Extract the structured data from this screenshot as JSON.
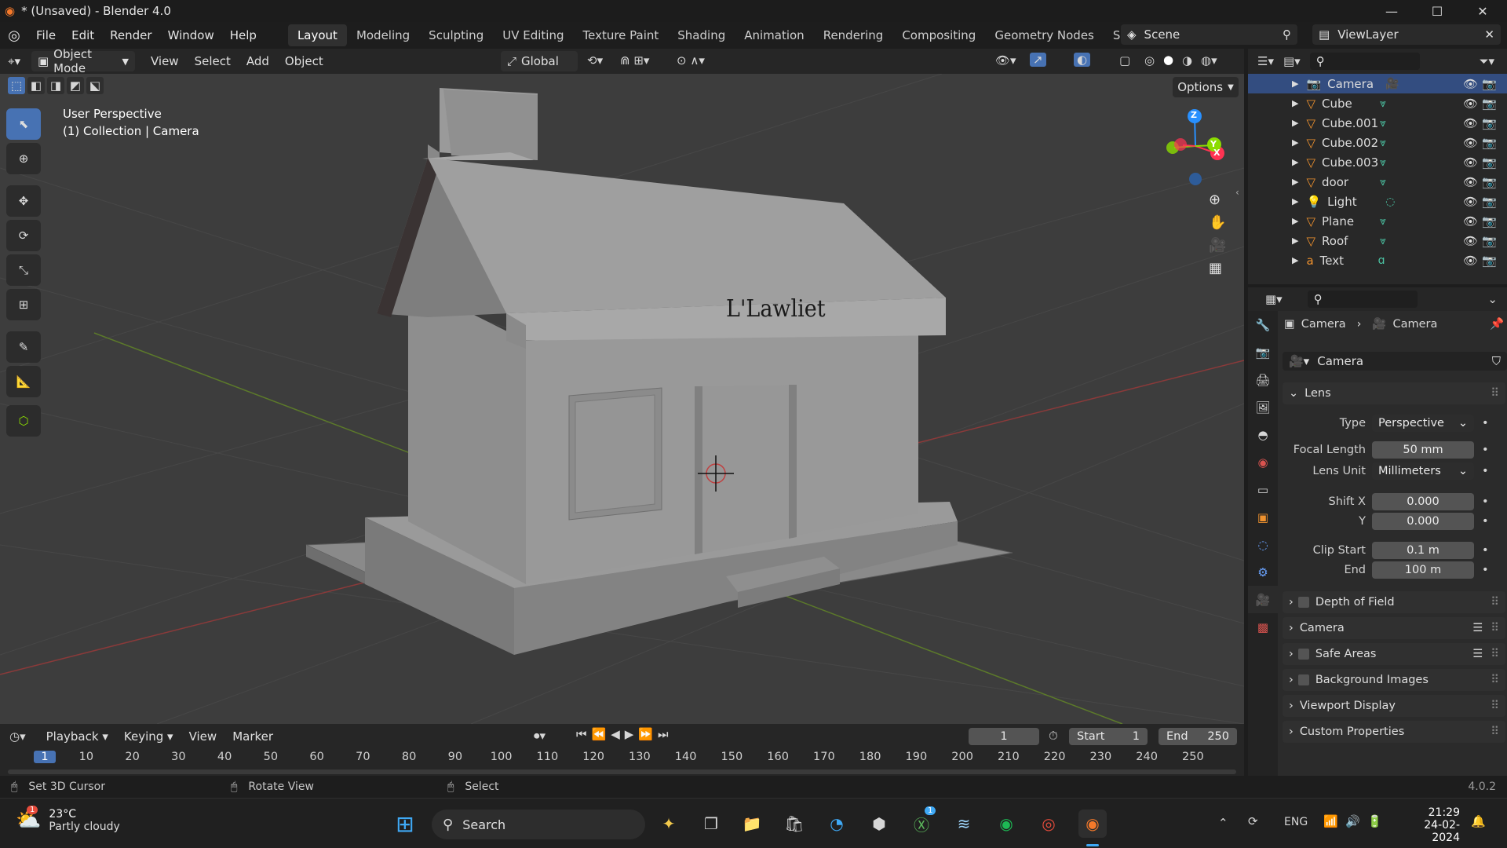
{
  "window": {
    "title": "* (Unsaved) - Blender 4.0",
    "minimize": "—",
    "maximize": "☐",
    "close": "✕"
  },
  "menu": {
    "items": [
      "File",
      "Edit",
      "Render",
      "Window",
      "Help"
    ]
  },
  "workspaces": {
    "tabs": [
      "Layout",
      "Modeling",
      "Sculpting",
      "UV Editing",
      "Texture Paint",
      "Shading",
      "Animation",
      "Rendering",
      "Compositing",
      "Geometry Nodes",
      "Scripting"
    ],
    "active": "Layout",
    "add": "+"
  },
  "scene": {
    "name": "Scene",
    "view_layer": "ViewLayer"
  },
  "viewport_header": {
    "mode": "Object Mode",
    "menus": [
      "View",
      "Select",
      "Add",
      "Object"
    ],
    "orientation": "Global",
    "options": "Options"
  },
  "viewport": {
    "perspective": "User Perspective",
    "context": "(1) Collection | Camera",
    "sign_text": "L'Lawliet"
  },
  "gizmo": {
    "x": "X",
    "y": "Y",
    "z": "Z"
  },
  "outliner": {
    "items": [
      {
        "name": "Camera",
        "type": "camera",
        "selected": true
      },
      {
        "name": "Cube",
        "type": "mesh",
        "selected": false
      },
      {
        "name": "Cube.001",
        "type": "mesh",
        "selected": false
      },
      {
        "name": "Cube.002",
        "type": "mesh",
        "selected": false
      },
      {
        "name": "Cube.003",
        "type": "mesh",
        "selected": false
      },
      {
        "name": "door",
        "type": "mesh",
        "selected": false
      },
      {
        "name": "Light",
        "type": "light",
        "selected": false
      },
      {
        "name": "Plane",
        "type": "mesh",
        "selected": false
      },
      {
        "name": "Roof",
        "type": "mesh",
        "selected": false
      },
      {
        "name": "Text",
        "type": "text",
        "selected": false
      }
    ]
  },
  "properties": {
    "breadcrumb": [
      "Camera",
      "Camera"
    ],
    "datablock": "Camera",
    "lens_section": "Lens",
    "type_label": "Type",
    "type_value": "Perspective",
    "focal_label": "Focal Length",
    "focal_value": "50 mm",
    "lens_unit_label": "Lens Unit",
    "lens_unit_value": "Millimeters",
    "shift_x_label": "Shift X",
    "shift_x_value": "0.000",
    "shift_y_label": "Y",
    "shift_y_value": "0.000",
    "clip_start_label": "Clip Start",
    "clip_start_value": "0.1 m",
    "clip_end_label": "End",
    "clip_end_value": "100 m",
    "panels": [
      "Depth of Field",
      "Camera",
      "Safe Areas",
      "Background Images",
      "Viewport Display",
      "Custom Properties"
    ]
  },
  "timeline": {
    "menus": [
      "Playback",
      "Keying",
      "View",
      "Marker"
    ],
    "current_frame": "1",
    "start_label": "Start",
    "start_value": "1",
    "end_label": "End",
    "end_value": "250",
    "ticks": [
      "1",
      "10",
      "20",
      "30",
      "40",
      "50",
      "60",
      "70",
      "80",
      "90",
      "100",
      "110",
      "120",
      "130",
      "140",
      "150",
      "160",
      "170",
      "180",
      "190",
      "200",
      "210",
      "220",
      "230",
      "240",
      "250"
    ]
  },
  "statusbar": {
    "left": "Set 3D Cursor",
    "middle": "Rotate View",
    "right": "Select",
    "version": "4.0.2"
  },
  "taskbar": {
    "temp": "23°C",
    "weather": "Partly cloudy",
    "search": "Search",
    "lang": "ENG",
    "time": "21:29",
    "date": "24-02-2024",
    "weather_badge": "1",
    "xbox_badge": "1"
  },
  "colors": {
    "accent": "#4772b3",
    "selection": "#334d80",
    "x_axis": "#ff3352",
    "y_axis": "#8bdc00",
    "z_axis": "#2890ff"
  }
}
